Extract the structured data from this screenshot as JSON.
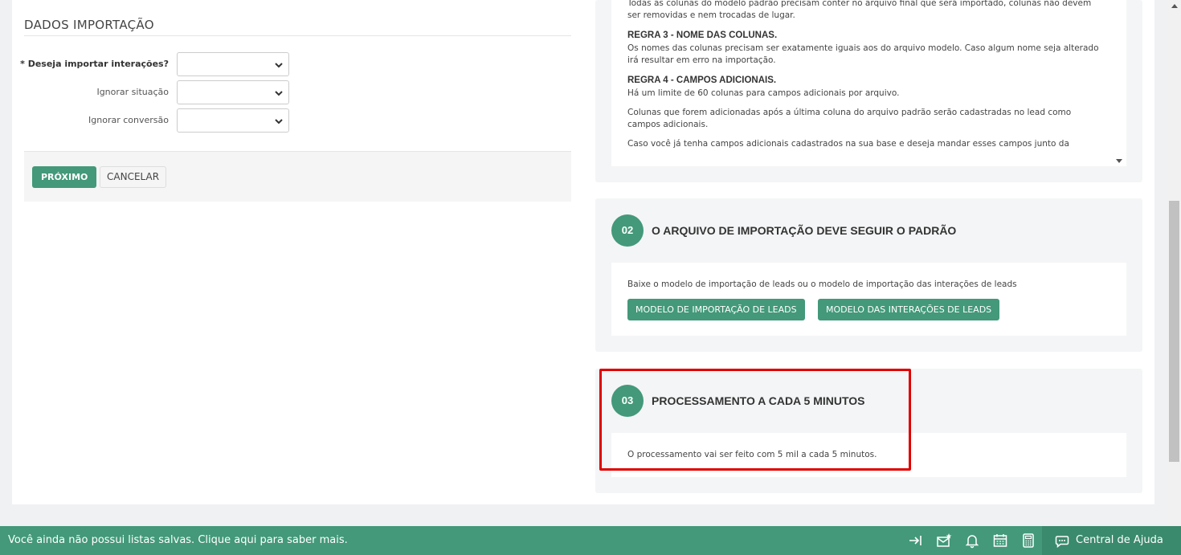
{
  "form": {
    "section_title": "DADOS IMPORTAÇÃO",
    "fields": [
      {
        "label": "* Deseja importar interações?",
        "value": ""
      },
      {
        "label": "Ignorar situação",
        "value": ""
      },
      {
        "label": "Ignorar conversão",
        "value": ""
      }
    ],
    "next_label": "PRÓXIMO",
    "cancel_label": "CANCELAR"
  },
  "rules": {
    "intro_text": "Todas as colunas do modelo padrão precisam conter no arquivo final que será importado, colunas não devem ser removidas e nem trocadas de lugar.",
    "rule3_title": "REGRA 3 - NOME DAS COLUNAS.",
    "rule3_text": "Os nomes das colunas precisam ser exatamente iguais aos do arquivo modelo. Caso algum nome seja alterado irá resultar em erro na importação.",
    "rule4_title": "REGRA 4 - CAMPOS ADICIONAIS.",
    "rule4_text1": "Há um limite de 60 colunas para campos adicionais por arquivo.",
    "rule4_text2": "Colunas que forem adicionadas após a última coluna do arquivo padrão serão cadastradas no lead como campos adicionais.",
    "rule4_text3": "Caso você já tenha campos adicionais cadastrados na sua base e deseja mandar esses campos junto da"
  },
  "step2": {
    "number": "02",
    "title": "O ARQUIVO DE IMPORTAÇÃO DEVE SEGUIR O PADRÃO",
    "text": "Baixe o modelo de importação de leads ou o modelo de importação das interações de leads",
    "btn_leads": "MODELO DE IMPORTAÇÃO DE LEADS",
    "btn_interactions": "MODELO DAS INTERAÇÕES DE LEADS"
  },
  "step3": {
    "number": "03",
    "title": "PROCESSAMENTO A CADA 5 MINUTOS",
    "text": "O processamento vai ser feito com 5 mil a cada 5 minutos."
  },
  "bottom_bar": {
    "message": "Você ainda não possui listas salvas. Clique aqui para saber mais.",
    "icons": [
      "collapse-right-icon",
      "mail-star-icon",
      "bell-icon",
      "calendar-icon",
      "calculator-icon"
    ],
    "help_label": "Central de Ajuda"
  },
  "colors": {
    "brand_green": "#43997a",
    "highlight_red": "#e00000"
  }
}
